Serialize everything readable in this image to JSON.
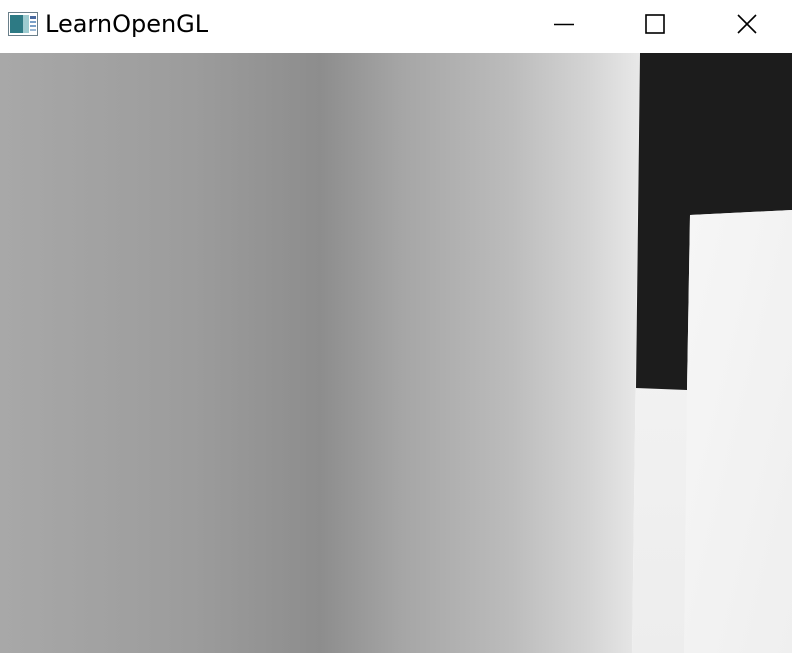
{
  "window": {
    "title": "LearnOpenGL",
    "icon": "opengl-app-icon",
    "controls": {
      "minimize_icon": "minimize-icon",
      "maximize_icon": "maximize-icon",
      "close_icon": "close-icon"
    }
  },
  "scene": {
    "description_colors": {
      "wall_dark": "#8c8c8c",
      "wall_light": "#e6e6e6",
      "shadow_block": "#1c1c1c",
      "floor_light": "#f2f2f2"
    }
  }
}
